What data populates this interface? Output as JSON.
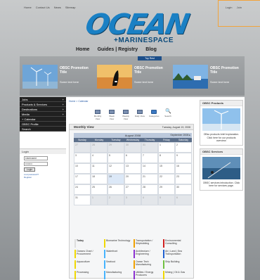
{
  "topbar": {
    "links": [
      "Home",
      "Contact Us",
      "News",
      "Sitemap"
    ],
    "login": "Login",
    "join": "Join"
  },
  "brand": {
    "word": "OCEAN",
    "sub": "+MARINESPACE"
  },
  "nav": {
    "items": [
      "Home",
      "Guides | Registry",
      "Blog"
    ]
  },
  "strip": {
    "tab": "Top Rest",
    "promos": [
      {
        "title": "OBSC Promotion Title",
        "more": "Some text here"
      },
      {
        "title": "OBSC Promotion Title",
        "more": "Some text here"
      },
      {
        "title": "OBSC Promotion Title",
        "more": "Some text here"
      }
    ]
  },
  "menu": [
    {
      "label": "Jobs",
      "arrow": "+"
    },
    {
      "label": "Products & Services",
      "arrow": "+"
    },
    {
      "label": "Destinations",
      "arrow": "+"
    },
    {
      "label": "Media",
      "arrow": "+"
    },
    {
      "label": "+ Calendar",
      "arrow": ""
    },
    {
      "label": "OBSC Profile",
      "arrow": ""
    },
    {
      "label": "Search",
      "arrow": ""
    }
  ],
  "login": {
    "title": "Login",
    "username": "Username",
    "password": "••••••••",
    "button": "Login",
    "forgot": "Lost password?",
    "register": "Register"
  },
  "breadcrumb": "Home > Calendar",
  "toolbar": [
    "Monthly View",
    "Week View",
    "Weekly View",
    "Daily View",
    "Categories",
    "Search"
  ],
  "calendar": {
    "view_title": "Monthly View",
    "today": "Tuesday, August 19, 2008",
    "month": "August 2008",
    "next": "September 2008 ▸",
    "dow": [
      "Sunday",
      "Monday",
      "Tuesday",
      "Wednesday",
      "Thursday",
      "Friday",
      "Saturday"
    ],
    "weeks": [
      [
        "27",
        "28",
        "29",
        "30",
        "31",
        "1",
        "2"
      ],
      [
        "3",
        "4",
        "5",
        "6",
        "7",
        "8",
        "9"
      ],
      [
        "10",
        "11",
        "12",
        "13",
        "14",
        "15",
        "16"
      ],
      [
        "17",
        "18",
        "19",
        "20",
        "21",
        "22",
        "23"
      ],
      [
        "24",
        "25",
        "26",
        "27",
        "28",
        "29",
        "30"
      ],
      [
        "31",
        "1",
        "2",
        "3",
        "4",
        "5",
        "6"
      ]
    ],
    "highlight_day": "19"
  },
  "categories": [
    [
      {
        "label": "Today",
        "color": "#ffffff"
      },
      {
        "label": "Biomarine Technology",
        "color": "#f0d800"
      },
      {
        "label": "Transportation / Shipbuilding",
        "color": "#f0a000"
      },
      {
        "label": "Environmental Consulting",
        "color": "#d02020"
      }
    ],
    [
      {
        "label": "Oceans Chart / Procurement",
        "color": "#f0d800"
      },
      {
        "label": "Waterfront",
        "color": "#46b4ff"
      },
      {
        "label": "Architecture / Engineering",
        "color": "#8a30d0"
      },
      {
        "label": "Air | Land | Sea Transportation",
        "color": "#2060d0"
      }
    ],
    [
      {
        "label": "Aquaculture",
        "color": "#f0d800"
      },
      {
        "label": "Seafood",
        "color": "#46b4ff"
      },
      {
        "label": "Ocean Tech Manufacturing",
        "color": "#f0a000"
      },
      {
        "label": "Ship Building",
        "color": "#70c040"
      }
    ],
    [
      {
        "label": "Processing",
        "color": "#f0d800"
      },
      {
        "label": "Manufacturing",
        "color": "#46b4ff"
      },
      {
        "label": "Utilities / Energy Producers",
        "color": "#8a30d0"
      },
      {
        "label": "Mining | Oil & Gas",
        "color": "#f0d800"
      }
    ]
  ],
  "sidebar": {
    "products": {
      "title": "OBSC Products",
      "text": "OBsc products brief explanation. Click here for our products overview."
    },
    "services": {
      "title": "OBSC Services",
      "text": "OBSC services introduction. Click here for services page."
    }
  }
}
